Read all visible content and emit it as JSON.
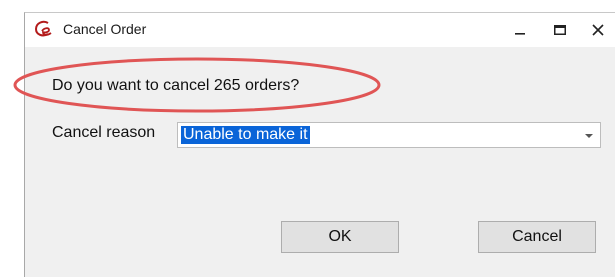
{
  "window": {
    "title": "Cancel Order",
    "icons": {
      "app": "app-logo-icon",
      "minimize": "minimize-icon",
      "maximize": "maximize-icon",
      "close": "close-icon"
    }
  },
  "dialog": {
    "question": "Do you want to cancel 265 orders?",
    "reason_label": "Cancel reason",
    "reason_value": "Unable to make it",
    "ok_label": "OK",
    "cancel_label": "Cancel"
  },
  "colors": {
    "highlight": "#e05555",
    "selection": "#0a64d8",
    "app_icon": "#b31b1b"
  }
}
